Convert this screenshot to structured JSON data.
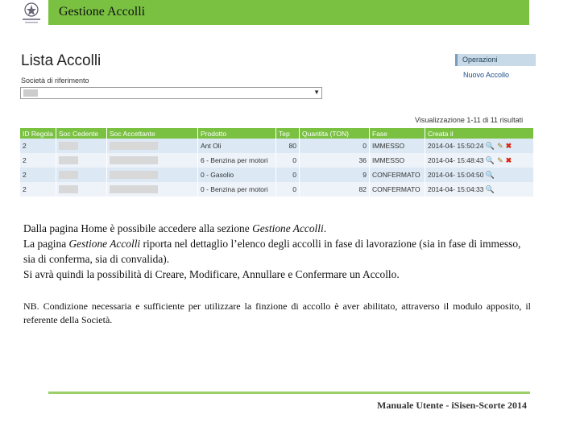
{
  "header": {
    "title": "Gestione Accolli"
  },
  "screenshot": {
    "title": "Lista Accolli",
    "societa_label": "Società di riferimento",
    "operations": {
      "heading": "Operazioni",
      "item": "Nuovo Accollo"
    },
    "visualization": "Visualizzazione 1-11 di 11 risultati",
    "table": {
      "headers": [
        "ID Regola",
        "Soc Cedente",
        "Soc Accettante",
        "Prodotto",
        "Tep",
        "Quantita (TON)",
        "Fase",
        "Creata il"
      ],
      "rows": [
        {
          "id": "2",
          "prodotto": "Ant Oli",
          "tep": "80",
          "quantita": "0",
          "fase": "IMMESSO",
          "creata": "2014-04-",
          "ora": "15:50:24"
        },
        {
          "id": "2",
          "prodotto": "6 - Benzina per motori",
          "tep": "0",
          "quantita": "36",
          "fase": "IMMESSO",
          "creata": "2014-04-",
          "ora": "15:48:43"
        },
        {
          "id": "2",
          "prodotto": "0 - Gasolio",
          "tep": "0",
          "quantita": "9",
          "fase": "CONFERMATO",
          "creata": "2014-04-",
          "ora": "15:04:50"
        },
        {
          "id": "2",
          "prodotto": "0 - Benzina per motori",
          "tep": "0",
          "quantita": "82",
          "fase": "CONFERMATO",
          "creata": "2014-04-",
          "ora": "15:04:33"
        }
      ]
    }
  },
  "body": {
    "p1a": "Dalla pagina Home è possibile accedere alla sezione ",
    "p1b": "Gestione Accolli",
    "p1c": ".",
    "p2a": "La pagina ",
    "p2b": "Gestione Accolli",
    "p2c": " riporta nel dettaglio l’elenco degli accolli in fase di lavorazione (sia in fase di immesso, sia di conferma, sia di convalida).",
    "p3": "Si avrà quindi la possibilità di Creare, Modificare, Annullare e Confermare un Accollo.",
    "nb": "NB. Condizione necessaria e sufficiente per utilizzare la finzione di accollo è aver abilitato, attraverso il modulo apposito, il referente della Società."
  },
  "footer": {
    "text": "Manuale Utente - iSisen-Scorte 2014"
  }
}
